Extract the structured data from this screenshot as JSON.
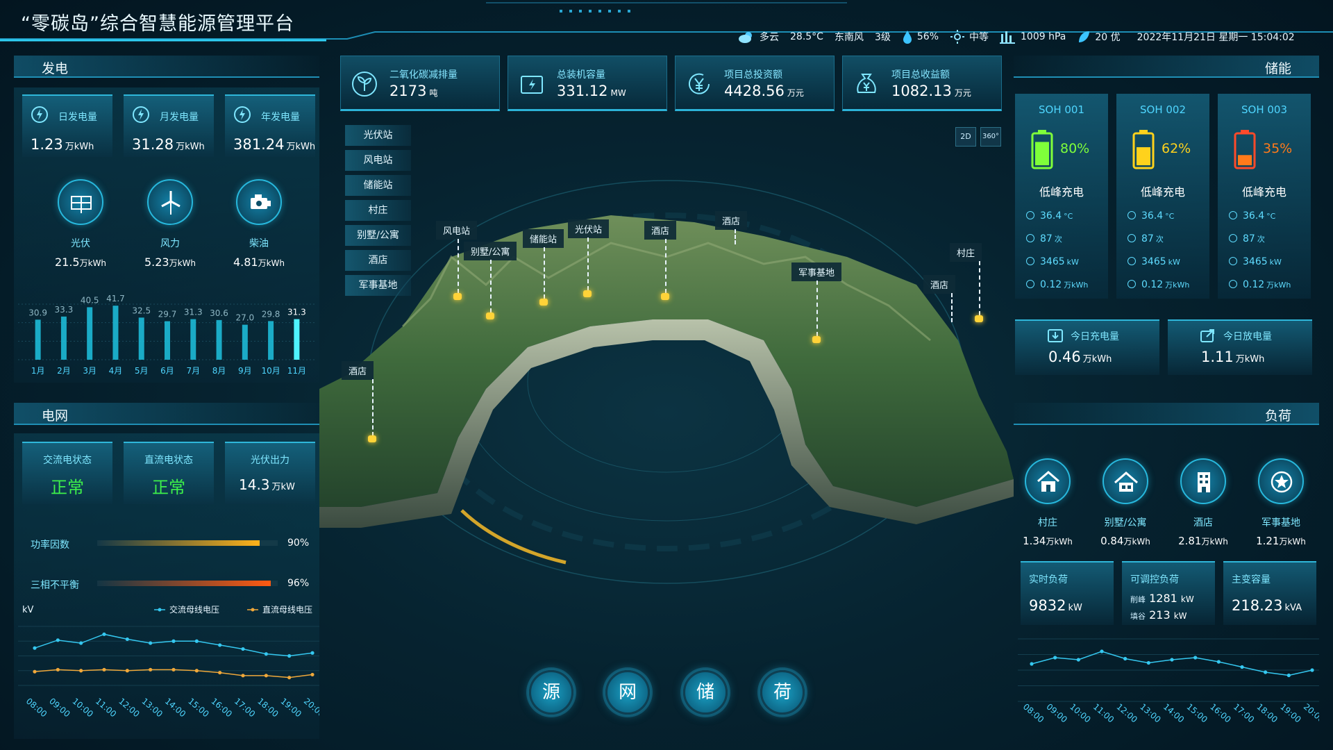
{
  "header": {
    "title": "“零碳岛”综合智慧能源管理平台"
  },
  "weather": {
    "condition": "多云",
    "temperature": "28.5°C",
    "wind_dir": "东南风",
    "wind_level": "3级",
    "humidity": "56%",
    "uv": "中等",
    "pressure": "1009 hPa",
    "aqi": "20 优",
    "datetime": "2022年11月21日  星期一  15:04:02"
  },
  "gen": {
    "title": "发电",
    "tiles": [
      {
        "label": "日发电量",
        "value": "1.23",
        "unit": "万kWh"
      },
      {
        "label": "月发电量",
        "value": "31.28",
        "unit": "万kWh"
      },
      {
        "label": "年发电量",
        "value": "381.24",
        "unit": "万kWh"
      }
    ],
    "sources": [
      {
        "name": "光伏",
        "value": "21.5",
        "unit": "万kWh"
      },
      {
        "name": "风力",
        "value": "5.23",
        "unit": "万kWh"
      },
      {
        "name": "柴油",
        "value": "4.81",
        "unit": "万kWh"
      }
    ]
  },
  "kpis": [
    {
      "label": "二氧化碳减排量",
      "value": "2173",
      "unit": "吨"
    },
    {
      "label": "总装机容量",
      "value": "331.12",
      "unit": "MW"
    },
    {
      "label": "项目总投资额",
      "value": "4428.56",
      "unit": "万元"
    },
    {
      "label": "项目总收益额",
      "value": "1082.13",
      "unit": "万元"
    }
  ],
  "storage": {
    "title": "储能",
    "cards": [
      {
        "name": "SOH 001",
        "pct": "80%",
        "level": 0.8,
        "color": "#7fff3a",
        "mode": "低峰充电",
        "temp": "36.4",
        "temp_unit": "°C",
        "cycles": "87",
        "cycles_unit": "次",
        "power": "3465",
        "power_unit": "kW",
        "energy": "0.12",
        "energy_unit": "万kWh"
      },
      {
        "name": "SOH 002",
        "pct": "62%",
        "level": 0.62,
        "color": "#ffd21c",
        "mode": "低峰充电",
        "temp": "36.4",
        "temp_unit": "°C",
        "cycles": "87",
        "cycles_unit": "次",
        "power": "3465",
        "power_unit": "kW",
        "energy": "0.12",
        "energy_unit": "万kWh"
      },
      {
        "name": "SOH 003",
        "pct": "35%",
        "level": 0.35,
        "color": "#ff7a1a",
        "mode": "低峰充电",
        "temp": "36.4",
        "temp_unit": "°C",
        "cycles": "87",
        "cycles_unit": "次",
        "power": "3465",
        "power_unit": "kW",
        "energy": "0.12",
        "energy_unit": "万kWh"
      }
    ],
    "charge": {
      "label": "今日充电量",
      "value": "0.46",
      "unit": "万kWh"
    },
    "discharge": {
      "label": "今日放电量",
      "value": "1.11",
      "unit": "万kWh"
    }
  },
  "grid": {
    "title": "电网",
    "tiles": [
      {
        "label": "交流电状态",
        "value": "正常",
        "unit": ""
      },
      {
        "label": "直流电状态",
        "value": "正常",
        "unit": ""
      },
      {
        "label": "光伏出力",
        "value": "14.3",
        "unit": "万kW"
      }
    ],
    "power_factor": {
      "label": "功率因数",
      "value": "90%",
      "level": 0.9
    },
    "imbalance": {
      "label": "三相不平衡",
      "value": "96%",
      "level": 0.96
    },
    "kv_label": "kV"
  },
  "load": {
    "title": "负荷",
    "items": [
      {
        "name": "村庄",
        "value": "1.34",
        "unit": "万kWh"
      },
      {
        "name": "别墅/公寓",
        "value": "0.84",
        "unit": "万kWh"
      },
      {
        "name": "酒店",
        "value": "2.81",
        "unit": "万kWh"
      },
      {
        "name": "军事基地",
        "value": "1.21",
        "unit": "万kWh"
      }
    ],
    "realtime": {
      "label": "实时负荷",
      "value": "9832",
      "unit": "kW"
    },
    "adjustable": {
      "label": "可调控负荷",
      "peak_label": "削峰",
      "peak": "1281",
      "peak_unit": "kW",
      "valley_label": "填谷",
      "valley": "213",
      "valley_unit": "kW"
    },
    "transformer": {
      "label": "主变容量",
      "value": "218.23",
      "unit": "kVA"
    }
  },
  "map": {
    "nav": [
      "光伏站",
      "风电站",
      "储能站",
      "村庄",
      "别墅/公寓",
      "酒店",
      "军事基地"
    ],
    "labels": [
      "风电站",
      "别墅/公寓",
      "储能站",
      "光伏站",
      "酒店",
      "酒店",
      "军事基地",
      "酒店",
      "村庄",
      "酒店"
    ],
    "view2d": "2D",
    "view360": "360°"
  },
  "bottom_buttons": [
    "源",
    "网",
    "储",
    "荷"
  ],
  "chart_data": [
    {
      "type": "bar",
      "categories": [
        "1月",
        "2月",
        "3月",
        "4月",
        "5月",
        "6月",
        "7月",
        "8月",
        "9月",
        "10月",
        "11月"
      ],
      "values": [
        30.9,
        33.3,
        40.5,
        41.7,
        32.5,
        29.7,
        31.3,
        30.6,
        27.0,
        29.8,
        31.3
      ],
      "data_labels": [
        "30.9",
        "33.3",
        "40.5",
        "41.7",
        "32.5",
        "29.7",
        "31.3",
        "30.6",
        "27.0",
        "29.8",
        "31.3"
      ],
      "ylim": [
        0,
        45
      ]
    },
    {
      "type": "line",
      "ylabel": "kV",
      "categories": [
        "08:00",
        "09:00",
        "10:00",
        "11:00",
        "12:00",
        "13:00",
        "14:00",
        "15:00",
        "16:00",
        "17:00",
        "18:00",
        "19:00",
        "20:00"
      ],
      "series": [
        {
          "name": "交流母线电压",
          "color": "#35c8f0",
          "values": [
            38,
            46,
            43,
            52,
            47,
            43,
            45,
            45,
            41,
            37,
            32,
            30,
            33
          ]
        },
        {
          "name": "直流母线电压",
          "color": "#f0a83a",
          "values": [
            14,
            16,
            15,
            16,
            15,
            16,
            16,
            15,
            13,
            10,
            10,
            8,
            11
          ]
        }
      ],
      "ylim": [
        0,
        60
      ],
      "legend": "top-right"
    },
    {
      "type": "line",
      "categories": [
        "08:00",
        "09:00",
        "10:00",
        "11:00",
        "12:00",
        "13:00",
        "14:00",
        "15:00",
        "16:00",
        "17:00",
        "18:00",
        "19:00",
        "20:00"
      ],
      "series": [
        {
          "color": "#35c8f0",
          "values": [
            36,
            42,
            40,
            48,
            41,
            37,
            40,
            42,
            38,
            33,
            28,
            25,
            30
          ]
        }
      ],
      "ylim": [
        0,
        60
      ]
    }
  ]
}
